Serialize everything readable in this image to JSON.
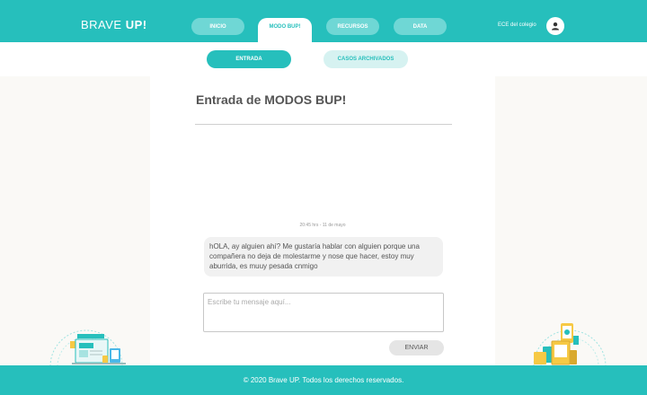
{
  "header": {
    "logo_light": "BRAVE ",
    "logo_bold": "UP!",
    "nav": [
      {
        "label": "INICIO"
      },
      {
        "label": "MODO BUP!"
      },
      {
        "label": "RECURSOS"
      },
      {
        "label": "DATA"
      }
    ],
    "user_label": "ECE del colegio",
    "avatar_icon": "user-icon"
  },
  "subnav": {
    "entrada": "ENTRADA",
    "archivados": "CASOS ARCHIVADOS"
  },
  "main": {
    "title": "Entrada de MODOS BUP!",
    "timestamp": "20:45 hrs - 11 de mayo",
    "message": "hOLA, ay alguien ahí? Me gustaría hablar con alguien porque una compañera no deja de molestarme y nose que hacer, estoy muy aburrida, es muuy pesada cnmigo",
    "input_placeholder": "Escribe tu mensaje aquí...",
    "send_label": "ENVIAR"
  },
  "footer": {
    "copyright": "© 2020 Brave UP. Todos los derechos reservados."
  },
  "colors": {
    "brand": "#26bfbc",
    "brand_light": "#6fd7d5",
    "background": "#faf9f6"
  }
}
